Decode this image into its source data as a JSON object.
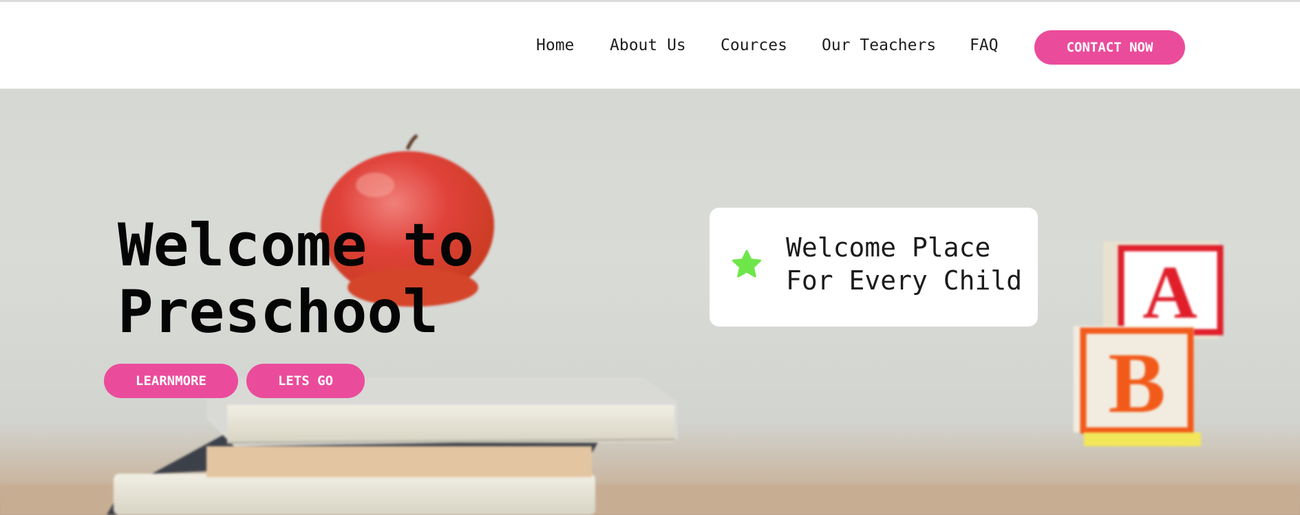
{
  "nav": {
    "items": [
      "Home",
      "About Us",
      "Cources",
      "Our Teachers",
      "FAQ"
    ],
    "contact_label": "CONTACT NOW"
  },
  "hero": {
    "title_line1": "Welcome to",
    "title_line2": "Preschool",
    "learn_label": "LEARNMORE",
    "go_label": "LETS GO",
    "background": "blurred photo of a red apple on a stack of books with red A and B toy blocks"
  },
  "card": {
    "line1": "Welcome Place",
    "line2": "For Every Child",
    "icon": "star-icon"
  },
  "colors": {
    "accent": "#ea4c9b",
    "star": "#6ee64a",
    "nav_text": "#1e1e1e",
    "title_text": "#050505"
  }
}
